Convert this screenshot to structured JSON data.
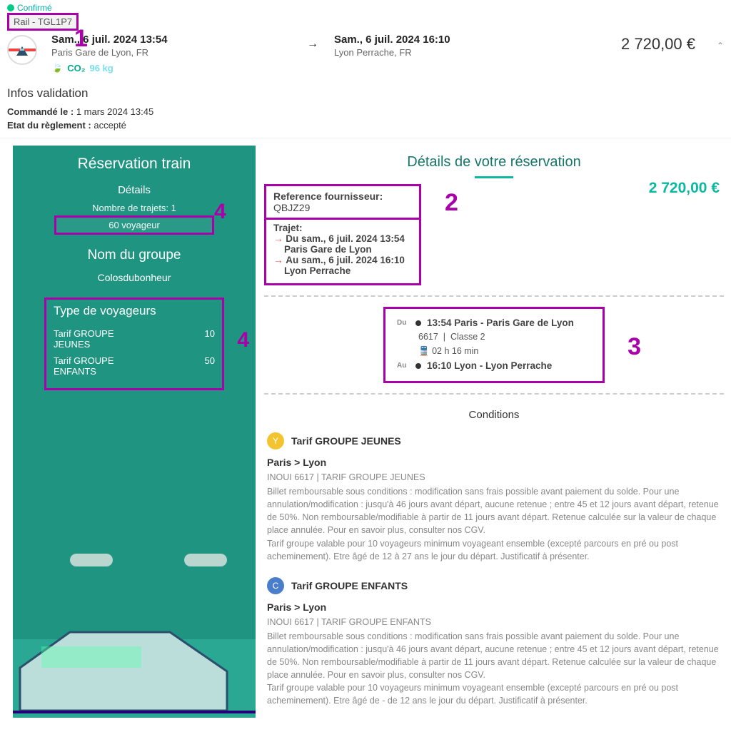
{
  "status": "Confirmé",
  "rail_tag": "Rail - TGL1P7",
  "departure": {
    "datetime": "Sam., 6 juil. 2024 13:54",
    "location": "Paris Gare de Lyon, FR"
  },
  "arrival": {
    "datetime": "Sam., 6 juil. 2024 16:10",
    "location": "Lyon Perrache, FR"
  },
  "price_total": "2 720,00 €",
  "co2": {
    "label": "CO₂",
    "value": "96 kg"
  },
  "validation": {
    "title": "Infos validation",
    "ordered_label": "Commandé le :",
    "ordered_value": "1 mars 2024 13:45",
    "payment_label": "Etat du règlement :",
    "payment_value": "accepté"
  },
  "sidebar": {
    "title": "Réservation train",
    "details_label": "Détails",
    "trips_label": "Nombre de trajets: 1",
    "travelers": "60 voyageur",
    "group_label": "Nom du groupe",
    "group_name": "Colosdubonheur",
    "types": {
      "title": "Type de voyageurs",
      "rows": [
        {
          "name": "Tarif GROUPE JEUNES",
          "count": "10"
        },
        {
          "name": "Tarif GROUPE ENFANTS",
          "count": "50"
        }
      ]
    }
  },
  "details": {
    "title": "Détails de votre réservation",
    "price": "2 720,00 €",
    "ref_label": "Reference fournisseur:",
    "ref_value": "QBJZ29",
    "trajet_label": "Trajet:",
    "trajet": {
      "from_label": "Du",
      "from_dt": "sam., 6 juil. 2024 13:54",
      "from_loc": "Paris Gare de Lyon",
      "to_label": "Au",
      "to_dt": "sam., 6 juil. 2024 16:10",
      "to_loc": "Lyon Perrache"
    },
    "schedule": {
      "du": "Du",
      "dep_time": "13:54 Paris - Paris Gare de Lyon",
      "train_no": "6617",
      "class": "Classe 2",
      "duration": "02 h 16 min",
      "au": "Au",
      "arr_time": "16:10 Lyon - Lyon Perrache"
    },
    "conditions_title": "Conditions",
    "fares": [
      {
        "badge": "Y",
        "badge_class": "fb-y",
        "name": "Tarif GROUPE JEUNES",
        "route": "Paris > Lyon",
        "sub": "INOUI 6617 | TARIF GROUPE JEUNES",
        "text": "Billet remboursable sous conditions : modification sans frais possible avant paiement du solde. Pour une annulation/modification : jusqu'à 46 jours avant départ, aucune retenue ; entre 45 et 12 jours avant départ, retenue de 50%. Non remboursable/modifiable à partir de 11 jours avant départ. Retenue calculée sur la valeur de chaque place annulée. Pour en savoir plus, consulter nos CGV.\nTarif groupe valable pour 10 voyageurs minimum voyageant ensemble (excepté parcours en pré ou post acheminement). Etre âgé de 12 à 27 ans le jour du départ. Justificatif à présenter."
      },
      {
        "badge": "C",
        "badge_class": "fb-c",
        "name": "Tarif GROUPE ENFANTS",
        "route": "Paris > Lyon",
        "sub": "INOUI 6617 | TARIF GROUPE ENFANTS",
        "text": "Billet remboursable sous conditions : modification sans frais possible avant paiement du solde. Pour une annulation/modification : jusqu'à 46 jours avant départ, aucune retenue ; entre 45 et 12 jours avant départ, retenue de 50%. Non remboursable/modifiable à partir de 11 jours avant départ. Retenue calculée sur la valeur de chaque place annulée. Pour en savoir plus, consulter nos CGV.\nTarif groupe valable pour 10 voyageurs minimum voyageant ensemble (excepté parcours en pré ou post acheminement). Etre âgé de - de 12 ans le jour du départ. Justificatif à présenter."
      }
    ]
  },
  "annotations": {
    "a1": "1",
    "a2": "2",
    "a3": "3",
    "a4": "4"
  }
}
